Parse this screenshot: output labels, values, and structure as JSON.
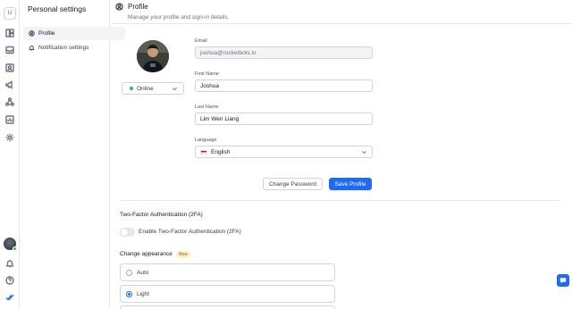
{
  "rail": {
    "workspace_initial": "U",
    "icons": [
      "dashboard-icon",
      "inbox-icon",
      "contacts-icon",
      "broadcast-icon",
      "workflows-icon",
      "reports-icon",
      "settings-icon"
    ],
    "bottom_icons": [
      "bell-icon",
      "help-icon",
      "logo-icon"
    ]
  },
  "sidebar": {
    "title": "Personal settings",
    "items": [
      {
        "label": "Profile",
        "icon": "user-circle-icon"
      },
      {
        "label": "Notification settings",
        "icon": "bell-icon"
      }
    ]
  },
  "header": {
    "title": "Profile",
    "subtitle": "Manage your profile and sign-in details."
  },
  "profile": {
    "status": "Online",
    "email_label": "Email",
    "email_value": "joshua@rocketbots.io",
    "first_name_label": "First Name",
    "first_name_value": "Joshua",
    "last_name_label": "Last Name",
    "last_name_value": "Lim Wen Liang",
    "language_label": "Language",
    "language_value": "English",
    "change_password": "Change Password",
    "save_profile": "Save Profile"
  },
  "two_factor": {
    "title": "Two-Factor Authentication (2FA)",
    "toggle_label": "Enable Two-Factor Authentication (2FA)",
    "enabled": false
  },
  "appearance": {
    "title": "Change appearance",
    "badge": "New",
    "options": [
      "Auto",
      "Light"
    ],
    "selected": "Light"
  },
  "colors": {
    "primary": "#1d6bf2",
    "online": "#22c55e",
    "badge_bg": "#fef3c7",
    "badge_text": "#b45309"
  }
}
